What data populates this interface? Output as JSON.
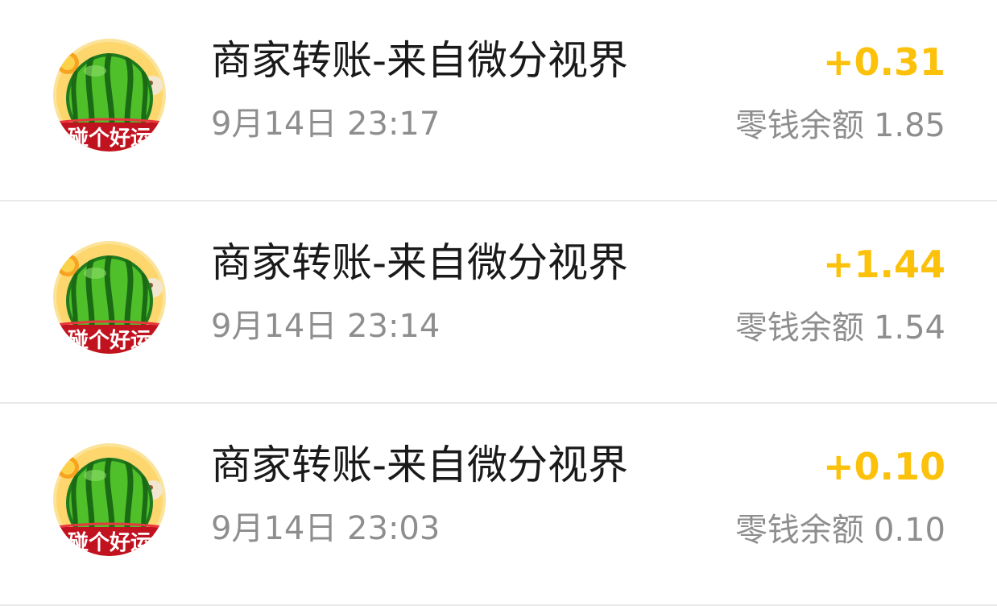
{
  "colors": {
    "amount": "#fcc10a",
    "secondary_text": "#8e8e8e",
    "divider": "#e9e9e9"
  },
  "transactions": [
    {
      "avatar_icon": "watermelon-avatar-icon",
      "avatar_text": "碰个好运",
      "title": "商家转账-来自微分视界",
      "time": "9月14日 23:17",
      "amount": "+0.31",
      "balance_label": "零钱余额",
      "balance_value": "1.85"
    },
    {
      "avatar_icon": "watermelon-avatar-icon",
      "avatar_text": "碰个好运",
      "title": "商家转账-来自微分视界",
      "time": "9月14日 23:14",
      "amount": "+1.44",
      "balance_label": "零钱余额",
      "balance_value": "1.54"
    },
    {
      "avatar_icon": "watermelon-avatar-icon",
      "avatar_text": "碰个好运",
      "title": "商家转账-来自微分视界",
      "time": "9月14日 23:03",
      "amount": "+0.10",
      "balance_label": "零钱余额",
      "balance_value": "0.10"
    }
  ]
}
